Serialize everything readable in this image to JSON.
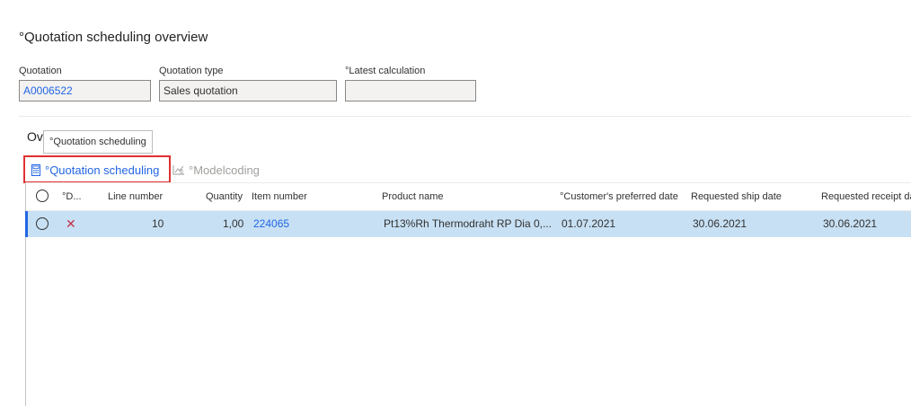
{
  "page": {
    "title": "°Quotation scheduling overview"
  },
  "fields": {
    "quotation": {
      "label": "Quotation",
      "value": "A0006522"
    },
    "quotation_type": {
      "label": "Quotation type",
      "value": "Sales quotation"
    },
    "latest_calculation": {
      "label": "°Latest calculation",
      "value": ""
    }
  },
  "section": {
    "title": "Ov"
  },
  "tooltip": {
    "text": "°Quotation scheduling"
  },
  "toolbar": {
    "quotation_scheduling_label": "°Quotation scheduling",
    "modelcoding_label": "°Modelcoding"
  },
  "grid": {
    "columns": {
      "d": "°D...",
      "line_number": "Line number",
      "quantity": "Quantity",
      "item_number": "Item number",
      "product_name": "Product name",
      "customer_preferred_date": "°Customer's preferred date",
      "requested_ship_date": "Requested ship date",
      "requested_receipt_date": "Requested receipt da"
    },
    "rows": [
      {
        "line_number": "10",
        "quantity": "1,00",
        "item_number": "224065",
        "product_name": "Pt13%Rh Thermodraht RP Dia 0,...",
        "customer_preferred_date": "01.07.2021",
        "requested_ship_date": "30.06.2021",
        "requested_receipt_date": "30.06.2021"
      }
    ]
  },
  "icons": {
    "scheduling": "calculator-icon",
    "modelcoding": "chart-icon",
    "delete": "x-mark-icon"
  },
  "colors": {
    "accent": "#2266e3",
    "selected_row": "#c7e0f4",
    "highlight": "#e03131",
    "delete": "#c4314b"
  }
}
